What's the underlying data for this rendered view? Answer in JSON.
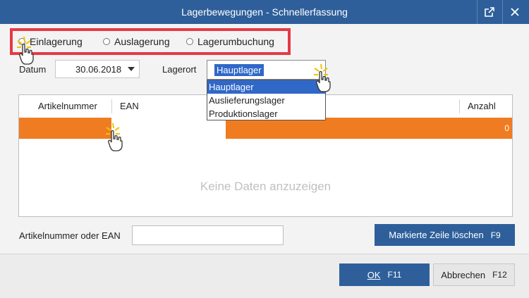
{
  "window": {
    "title": "Lagerbewegungen - Schnellerfassung"
  },
  "movement_type": {
    "options": [
      "Einlagerung",
      "Auslagerung",
      "Lagerumbuchung"
    ],
    "selected": "Einlagerung"
  },
  "date": {
    "label": "Datum",
    "value": "30.06.2018"
  },
  "storage": {
    "label": "Lagerort",
    "value": "Hauptlager",
    "options": [
      "Hauptlager",
      "Auslieferungslager",
      "Produktionslager"
    ]
  },
  "grid": {
    "columns": [
      "Artikelnummer",
      "EAN",
      "Anzahl"
    ],
    "row_count_value": "0",
    "empty_text": "Keine Daten anzuzeigen"
  },
  "search": {
    "label": "Artikelnummer oder EAN",
    "value": ""
  },
  "buttons": {
    "delete_label": "Markierte Zeile löschen",
    "delete_key": "F9",
    "ok_label": "OK",
    "ok_key": "F11",
    "cancel_label": "Abbrechen",
    "cancel_key": "F12"
  },
  "colors": {
    "titlebar": "#2e5f9a",
    "highlight_border": "#e63946",
    "active_row": "#f07c22",
    "selection": "#3068c8"
  }
}
